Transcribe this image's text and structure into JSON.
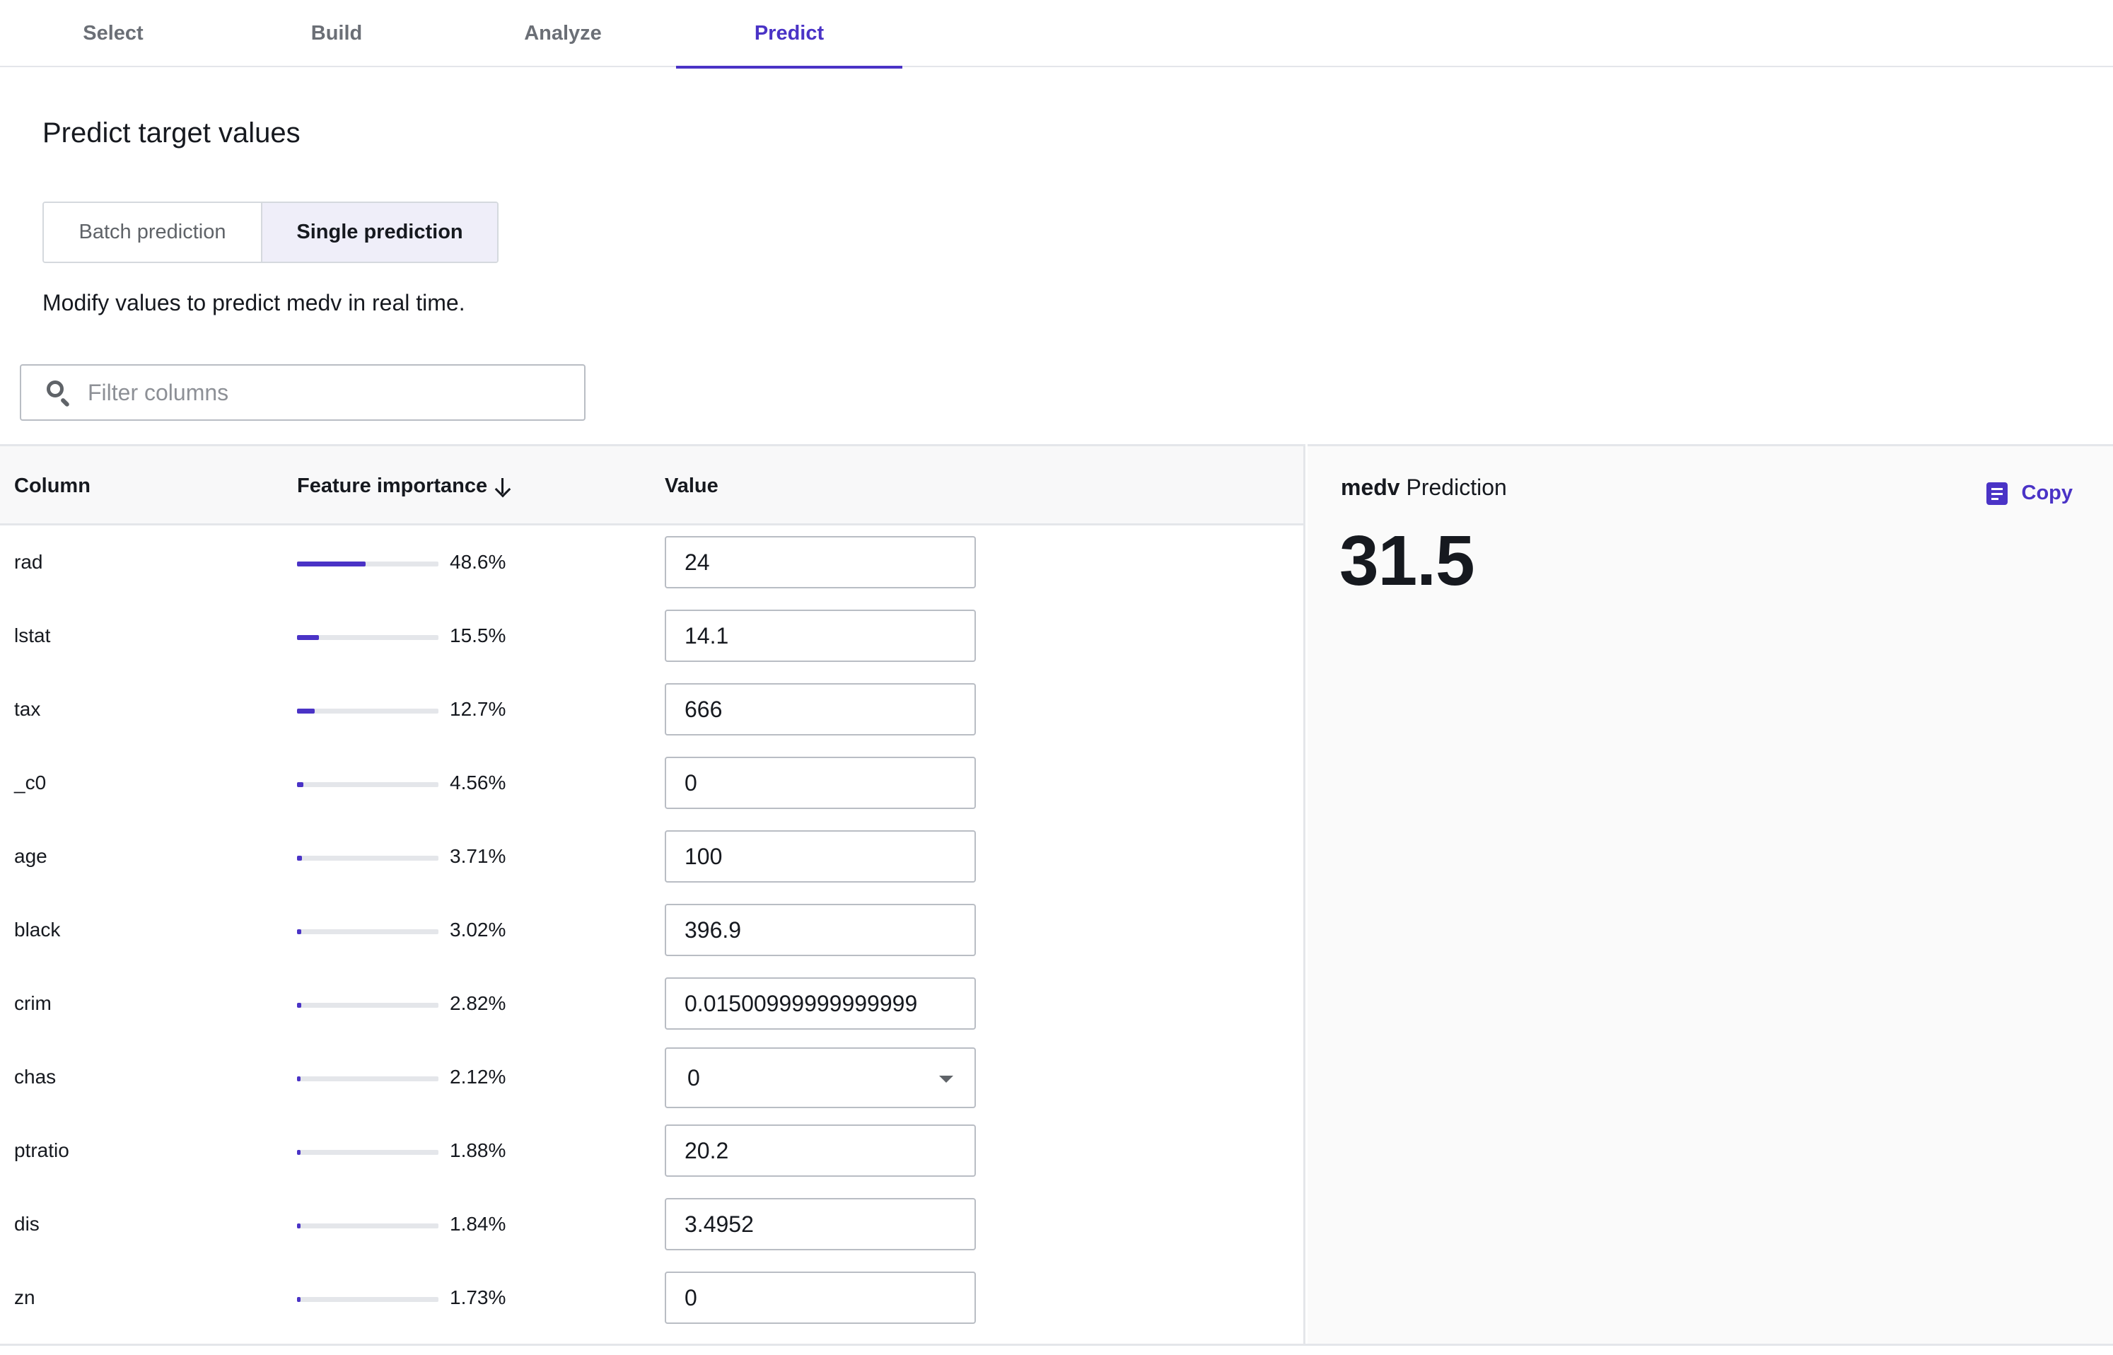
{
  "tabs": [
    {
      "label": "Select"
    },
    {
      "label": "Build"
    },
    {
      "label": "Analyze"
    },
    {
      "label": "Predict"
    }
  ],
  "page": {
    "title": "Predict target values",
    "segments": {
      "batch": "Batch prediction",
      "single": "Single prediction"
    },
    "description": "Modify values to predict medv in real time."
  },
  "search": {
    "placeholder": "Filter columns"
  },
  "table": {
    "headers": {
      "column": "Column",
      "importance": "Feature importance",
      "value": "Value"
    },
    "rows": [
      {
        "name": "rad",
        "importance_label": "48.6%",
        "importance": 0.486,
        "value": "24"
      },
      {
        "name": "lstat",
        "importance_label": "15.5%",
        "importance": 0.155,
        "value": "14.1"
      },
      {
        "name": "tax",
        "importance_label": "12.7%",
        "importance": 0.127,
        "value": "666"
      },
      {
        "name": "_c0",
        "importance_label": "4.56%",
        "importance": 0.0456,
        "value": "0"
      },
      {
        "name": "age",
        "importance_label": "3.71%",
        "importance": 0.0371,
        "value": "100"
      },
      {
        "name": "black",
        "importance_label": "3.02%",
        "importance": 0.0302,
        "value": "396.9"
      },
      {
        "name": "crim",
        "importance_label": "2.82%",
        "importance": 0.0282,
        "value": "0.01500999999999999"
      },
      {
        "name": "chas",
        "importance_label": "2.12%",
        "importance": 0.0212,
        "value": "0"
      },
      {
        "name": "ptratio",
        "importance_label": "1.88%",
        "importance": 0.0188,
        "value": "20.2"
      },
      {
        "name": "dis",
        "importance_label": "1.84%",
        "importance": 0.0184,
        "value": "3.4952"
      },
      {
        "name": "zn",
        "importance_label": "1.73%",
        "importance": 0.0173,
        "value": "0"
      }
    ]
  },
  "prediction": {
    "target": "medv",
    "label": "Prediction",
    "value": "31.5",
    "copy_label": "Copy"
  },
  "colors": {
    "accent": "#4a33c6",
    "border": "#e4e6ea"
  },
  "icons": [
    "search-icon",
    "sort-down-icon",
    "caret-down-icon",
    "copy-icon"
  ]
}
